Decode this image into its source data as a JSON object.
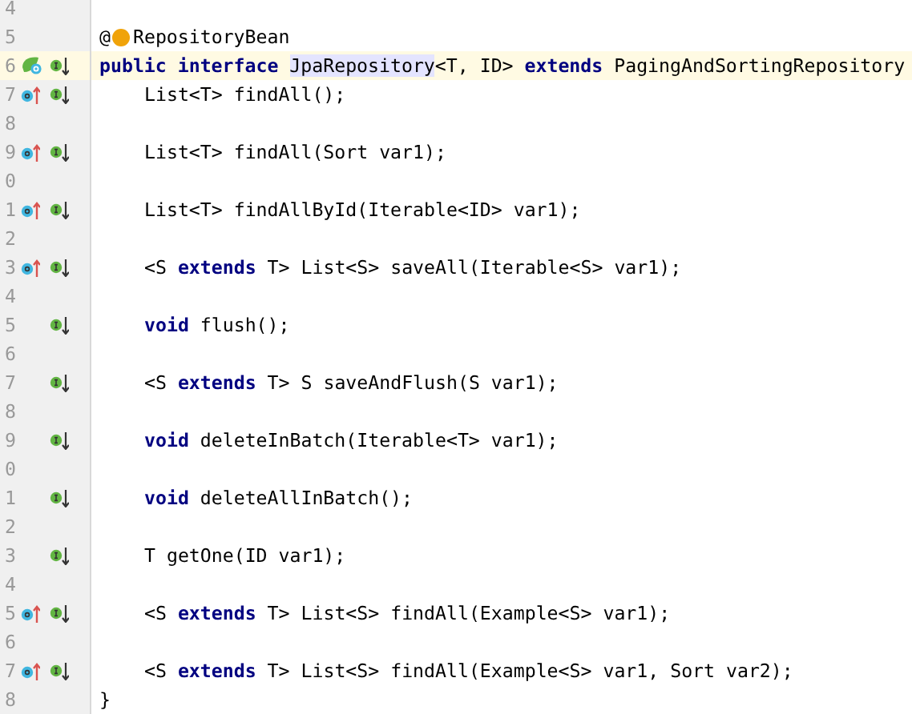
{
  "lines": [
    {
      "number": "4",
      "kind": "blank",
      "highlighted": false
    },
    {
      "number": "5",
      "kind": "top",
      "highlighted": false,
      "tokens": [
        {
          "text": "@",
          "kind": "plain"
        },
        {
          "kind": "bulb"
        },
        {
          "text": "RepositoryBean",
          "kind": "plain"
        }
      ]
    },
    {
      "number": "6",
      "kind": "top",
      "highlighted": true,
      "markers": [
        {
          "kind": "class"
        },
        {
          "kind": "implemented"
        }
      ],
      "tokens": [
        {
          "text": "public interface ",
          "kind": "keyword"
        },
        {
          "text": "JpaRepository",
          "kind": "match"
        },
        {
          "text": "<T, ID> ",
          "kind": "plain"
        },
        {
          "text": "extends",
          "kind": "keyword"
        },
        {
          "text": " PagingAndSortingRepository",
          "kind": "plain"
        }
      ]
    },
    {
      "number": "7",
      "kind": "member",
      "highlighted": false,
      "markers": [
        {
          "kind": "override"
        },
        {
          "kind": "implemented"
        }
      ],
      "tokens": [
        {
          "text": "List<T> findAll();",
          "kind": "plain"
        }
      ]
    },
    {
      "number": "8",
      "kind": "blank",
      "highlighted": false
    },
    {
      "number": "9",
      "kind": "member",
      "highlighted": false,
      "markers": [
        {
          "kind": "override"
        },
        {
          "kind": "implemented"
        }
      ],
      "tokens": [
        {
          "text": "List<T> findAll(Sort var1);",
          "kind": "plain"
        }
      ]
    },
    {
      "number": "0",
      "kind": "blank",
      "highlighted": false
    },
    {
      "number": "1",
      "kind": "member",
      "highlighted": false,
      "markers": [
        {
          "kind": "override"
        },
        {
          "kind": "implemented"
        }
      ],
      "tokens": [
        {
          "text": "List<T> findAllById(Iterable<ID> var1);",
          "kind": "plain"
        }
      ]
    },
    {
      "number": "2",
      "kind": "blank",
      "highlighted": false
    },
    {
      "number": "3",
      "kind": "member",
      "highlighted": false,
      "markers": [
        {
          "kind": "override"
        },
        {
          "kind": "implemented"
        }
      ],
      "tokens": [
        {
          "text": "<S ",
          "kind": "plain"
        },
        {
          "text": "extends",
          "kind": "keyword"
        },
        {
          "text": " T> List<S> saveAll(Iterable<S> var1);",
          "kind": "plain"
        }
      ]
    },
    {
      "number": "4",
      "kind": "blank",
      "highlighted": false
    },
    {
      "number": "5",
      "kind": "member",
      "highlighted": false,
      "markers": [
        {
          "kind": "implemented"
        }
      ],
      "tokens": [
        {
          "text": "void",
          "kind": "keyword"
        },
        {
          "text": " flush();",
          "kind": "plain"
        }
      ]
    },
    {
      "number": "6",
      "kind": "blank",
      "highlighted": false
    },
    {
      "number": "7",
      "kind": "member",
      "highlighted": false,
      "markers": [
        {
          "kind": "implemented"
        }
      ],
      "tokens": [
        {
          "text": "<S ",
          "kind": "plain"
        },
        {
          "text": "extends",
          "kind": "keyword"
        },
        {
          "text": " T> S saveAndFlush(S var1);",
          "kind": "plain"
        }
      ]
    },
    {
      "number": "8",
      "kind": "blank",
      "highlighted": false
    },
    {
      "number": "9",
      "kind": "member",
      "highlighted": false,
      "markers": [
        {
          "kind": "implemented"
        }
      ],
      "tokens": [
        {
          "text": "void",
          "kind": "keyword"
        },
        {
          "text": " deleteInBatch(Iterable<T> var1);",
          "kind": "plain"
        }
      ]
    },
    {
      "number": "0",
      "kind": "blank",
      "highlighted": false
    },
    {
      "number": "1",
      "kind": "member",
      "highlighted": false,
      "markers": [
        {
          "kind": "implemented"
        }
      ],
      "tokens": [
        {
          "text": "void",
          "kind": "keyword"
        },
        {
          "text": " deleteAllInBatch();",
          "kind": "plain"
        }
      ]
    },
    {
      "number": "2",
      "kind": "blank",
      "highlighted": false
    },
    {
      "number": "3",
      "kind": "member",
      "highlighted": false,
      "markers": [
        {
          "kind": "implemented"
        }
      ],
      "tokens": [
        {
          "text": "T getOne(ID var1);",
          "kind": "plain"
        }
      ]
    },
    {
      "number": "4",
      "kind": "blank",
      "highlighted": false
    },
    {
      "number": "5",
      "kind": "member",
      "highlighted": false,
      "markers": [
        {
          "kind": "override"
        },
        {
          "kind": "implemented"
        }
      ],
      "tokens": [
        {
          "text": "<S ",
          "kind": "plain"
        },
        {
          "text": "extends",
          "kind": "keyword"
        },
        {
          "text": " T> List<S> findAll(Example<S> var1);",
          "kind": "plain"
        }
      ]
    },
    {
      "number": "6",
      "kind": "blank",
      "highlighted": false
    },
    {
      "number": "7",
      "kind": "member",
      "highlighted": false,
      "markers": [
        {
          "kind": "override"
        },
        {
          "kind": "implemented"
        }
      ],
      "tokens": [
        {
          "text": "<S ",
          "kind": "plain"
        },
        {
          "text": "extends",
          "kind": "keyword"
        },
        {
          "text": " T> List<S> findAll(Example<S> var1, Sort var2);",
          "kind": "plain"
        }
      ]
    },
    {
      "number": "8",
      "kind": "top",
      "highlighted": false,
      "tokens": [
        {
          "text": "}",
          "kind": "plain"
        }
      ]
    }
  ]
}
